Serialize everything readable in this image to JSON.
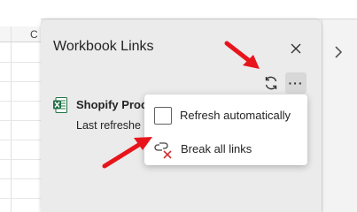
{
  "sheet": {
    "column_letter": "C"
  },
  "pane": {
    "title": "Workbook Links",
    "close_icon": "close-icon",
    "refresh_icon": "refresh-icon",
    "more_label": "···"
  },
  "link": {
    "name": "Shopify Proc",
    "status": "Last refreshe",
    "icon": "excel-icon"
  },
  "menu": {
    "items": [
      {
        "label": "Refresh automatically",
        "icon": "checkbox-unchecked",
        "checked": false
      },
      {
        "label": "Break all links",
        "icon": "break-links-icon"
      }
    ]
  },
  "colors": {
    "pane_bg": "#ebebeb",
    "excel_green": "#217346",
    "arrow_red": "#e8141c",
    "break_red": "#d13438"
  }
}
